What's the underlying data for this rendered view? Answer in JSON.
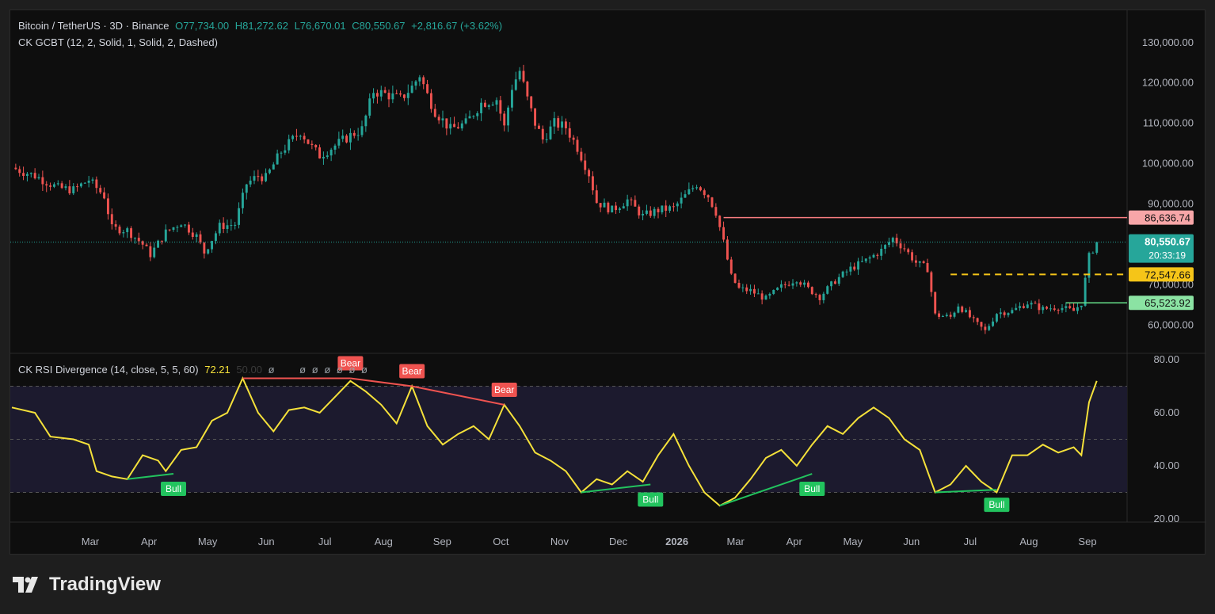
{
  "header": {
    "symbol": "Bitcoin / TetherUS · 3D · Binance",
    "open": "O77,734.00",
    "high": "H81,272.62",
    "low": "L76,670.01",
    "close": "C80,550.67",
    "change": "+2,816.67 (+3.62%)",
    "indicator1": "CK GCBT (12, 2, Solid, 1, Solid, 2, Dashed)"
  },
  "rsi_legend": {
    "title": "CK RSI Divergence (14, close, 5, 5, 60)",
    "value": "72.21",
    "secondary": "50.00",
    "empties": [
      "ø",
      "ø",
      "ø",
      "ø",
      "ø",
      "ø",
      "ø"
    ]
  },
  "colors": {
    "up": "#26a69a",
    "down": "#ef5350",
    "rsi": "#f5e13a",
    "bull": "#22c35e",
    "bear": "#ef5350",
    "resistance": "#f77c80",
    "mid": "#f5c518",
    "support": "#66e08a"
  },
  "price_labels": [
    {
      "value": "86,636.74",
      "price": 86636.74,
      "bg": "#f7a6a8",
      "fg": "#111"
    },
    {
      "value": "72,547.66",
      "price": 72547.66,
      "bg": "#f5c518",
      "fg": "#111"
    },
    {
      "value": "65,523.92",
      "price": 65523.92,
      "bg": "#8be3a3",
      "fg": "#111"
    }
  ],
  "current_price": {
    "value": "80,550.67",
    "countdown": "20:33:19",
    "price": 80550.67,
    "bg": "#26a69a"
  },
  "watermark": {
    "brand": "TradingView"
  },
  "chart_data": [
    {
      "type": "candlestick",
      "title": "Bitcoin / TetherUS · 3D · Binance",
      "y_ticks": [
        60000,
        70000,
        80000,
        90000,
        100000,
        110000,
        120000,
        130000
      ],
      "y_tick_labels": [
        "60,000.00",
        "70,000.00",
        "80,000.00",
        "90,000.00",
        "100,000.00",
        "110,000.00",
        "120,000.00",
        "130,000.00"
      ],
      "ylim": [
        53000,
        138000
      ],
      "x_labels": [
        "Mar",
        "Apr",
        "May",
        "Jun",
        "Jul",
        "Aug",
        "Sep",
        "Oct",
        "Nov",
        "Dec",
        "2026",
        "Mar",
        "Apr",
        "May",
        "Jun",
        "Jul",
        "Aug",
        "Sep"
      ],
      "bold_x_label": "2026",
      "close_path": [
        [
          0,
          99000
        ],
        [
          6,
          97000
        ],
        [
          12,
          94000
        ],
        [
          16,
          93500
        ],
        [
          20,
          96000
        ],
        [
          24,
          92000
        ],
        [
          26,
          84000
        ],
        [
          30,
          83500
        ],
        [
          34,
          80000
        ],
        [
          36,
          77500
        ],
        [
          40,
          83000
        ],
        [
          44,
          85500
        ],
        [
          48,
          82000
        ],
        [
          50,
          78000
        ],
        [
          54,
          84500
        ],
        [
          58,
          85000
        ],
        [
          61,
          95000
        ],
        [
          64,
          97000
        ],
        [
          66,
          96500
        ],
        [
          70,
          103000
        ],
        [
          72,
          105000
        ],
        [
          75,
          108000
        ],
        [
          78,
          104000
        ],
        [
          80,
          102000
        ],
        [
          84,
          104500
        ],
        [
          88,
          107000
        ],
        [
          91,
          108500
        ],
        [
          94,
          118000
        ],
        [
          98,
          117000
        ],
        [
          101,
          116000
        ],
        [
          104,
          119000
        ],
        [
          106,
          122000
        ],
        [
          108,
          117000
        ],
        [
          110,
          113000
        ],
        [
          114,
          108500
        ],
        [
          118,
          110000
        ],
        [
          122,
          115000
        ],
        [
          126,
          116000
        ],
        [
          128,
          109000
        ],
        [
          130,
          119000
        ],
        [
          132,
          123000
        ],
        [
          134,
          116000
        ],
        [
          136,
          110000
        ],
        [
          138,
          106000
        ],
        [
          141,
          110000
        ],
        [
          144,
          109000
        ],
        [
          147,
          104000
        ],
        [
          150,
          97500
        ],
        [
          152,
          90500
        ],
        [
          156,
          88500
        ],
        [
          160,
          91000
        ],
        [
          164,
          87000
        ],
        [
          168,
          88500
        ],
        [
          172,
          89000
        ],
        [
          175,
          92000
        ],
        [
          178,
          95000
        ],
        [
          181,
          92000
        ],
        [
          183,
          88000
        ],
        [
          185,
          80500
        ],
        [
          187,
          72000
        ],
        [
          189,
          69000
        ],
        [
          192,
          68500
        ],
        [
          196,
          66500
        ],
        [
          200,
          69500
        ],
        [
          204,
          71500
        ],
        [
          207,
          69000
        ],
        [
          210,
          67000
        ],
        [
          214,
          71000
        ],
        [
          218,
          74000
        ],
        [
          222,
          76000
        ],
        [
          226,
          78500
        ],
        [
          229,
          81500
        ],
        [
          232,
          79000
        ],
        [
          235,
          75500
        ],
        [
          238,
          74000
        ],
        [
          240,
          62500
        ],
        [
          244,
          62000
        ],
        [
          246,
          65000
        ],
        [
          250,
          61000
        ],
        [
          253,
          58500
        ],
        [
          256,
          63000
        ],
        [
          260,
          63500
        ],
        [
          264,
          65500
        ],
        [
          268,
          64000
        ],
        [
          272,
          64500
        ],
        [
          276,
          63500
        ],
        [
          278,
          65500
        ],
        [
          280,
          77000
        ],
        [
          282,
          80550
        ]
      ],
      "x_range": [
        0,
        287
      ],
      "horizontal_levels": [
        {
          "name": "resistance",
          "price": 86636.74,
          "from": 185,
          "style": "solid"
        },
        {
          "name": "mid",
          "price": 72547.66,
          "from": 244,
          "style": "dashed"
        },
        {
          "name": "support",
          "price": 65523.92,
          "from": 274,
          "style": "solid"
        }
      ]
    },
    {
      "type": "line",
      "title": "CK RSI Divergence (14, close, 5, 5, 60)",
      "y_ticks": [
        20,
        40,
        60,
        80
      ],
      "y_tick_labels": [
        "20.00",
        "40.00",
        "60.00",
        "80.00"
      ],
      "ylim": [
        20,
        80
      ],
      "band": [
        30,
        70
      ],
      "midline": 50,
      "rsi": [
        [
          0,
          62
        ],
        [
          6,
          60
        ],
        [
          10,
          51
        ],
        [
          16,
          50
        ],
        [
          20,
          48
        ],
        [
          22,
          38
        ],
        [
          26,
          36
        ],
        [
          30,
          35
        ],
        [
          34,
          44
        ],
        [
          38,
          42
        ],
        [
          40,
          38
        ],
        [
          44,
          46
        ],
        [
          48,
          47
        ],
        [
          52,
          57
        ],
        [
          56,
          60
        ],
        [
          60,
          73
        ],
        [
          64,
          60
        ],
        [
          68,
          53
        ],
        [
          72,
          61
        ],
        [
          76,
          62
        ],
        [
          80,
          60
        ],
        [
          84,
          66
        ],
        [
          88,
          72
        ],
        [
          92,
          68
        ],
        [
          96,
          63
        ],
        [
          100,
          56
        ],
        [
          104,
          70
        ],
        [
          108,
          55
        ],
        [
          112,
          48
        ],
        [
          116,
          52
        ],
        [
          120,
          55
        ],
        [
          124,
          50
        ],
        [
          128,
          63
        ],
        [
          132,
          55
        ],
        [
          136,
          45
        ],
        [
          140,
          42
        ],
        [
          144,
          38
        ],
        [
          148,
          30
        ],
        [
          152,
          35
        ],
        [
          156,
          33
        ],
        [
          160,
          38
        ],
        [
          164,
          34
        ],
        [
          168,
          44
        ],
        [
          172,
          52
        ],
        [
          176,
          40
        ],
        [
          180,
          30
        ],
        [
          184,
          25
        ],
        [
          188,
          28
        ],
        [
          192,
          35
        ],
        [
          196,
          43
        ],
        [
          200,
          46
        ],
        [
          204,
          40
        ],
        [
          208,
          48
        ],
        [
          212,
          55
        ],
        [
          216,
          52
        ],
        [
          220,
          58
        ],
        [
          224,
          62
        ],
        [
          228,
          58
        ],
        [
          232,
          50
        ],
        [
          236,
          46
        ],
        [
          240,
          30
        ],
        [
          244,
          33
        ],
        [
          248,
          40
        ],
        [
          252,
          34
        ],
        [
          256,
          30
        ],
        [
          260,
          44
        ],
        [
          264,
          44
        ],
        [
          268,
          48
        ],
        [
          272,
          45
        ],
        [
          276,
          47
        ],
        [
          278,
          44
        ],
        [
          280,
          64
        ],
        [
          282,
          72
        ]
      ],
      "divergences": [
        {
          "type": "Bull",
          "from": [
            30,
            35
          ],
          "to": [
            42,
            37
          ]
        },
        {
          "type": "Bear",
          "from": [
            60,
            73
          ],
          "to": [
            88,
            73
          ]
        },
        {
          "type": "Bear",
          "from": [
            88,
            73
          ],
          "to": [
            104,
            70
          ]
        },
        {
          "type": "Bear",
          "from": [
            104,
            70
          ],
          "to": [
            128,
            63
          ]
        },
        {
          "type": "Bull",
          "from": [
            148,
            30
          ],
          "to": [
            166,
            33
          ]
        },
        {
          "type": "Bull",
          "from": [
            184,
            25
          ],
          "to": [
            208,
            37
          ]
        },
        {
          "type": "Bull",
          "from": [
            240,
            30
          ],
          "to": [
            256,
            31
          ]
        }
      ],
      "labels": [
        {
          "text": "Bull",
          "at": [
            42,
            37
          ]
        },
        {
          "text": "Bear",
          "at": [
            88,
            73
          ]
        },
        {
          "text": "Bear",
          "at": [
            104,
            70
          ]
        },
        {
          "text": "Bear",
          "at": [
            128,
            63
          ]
        },
        {
          "text": "Bull",
          "at": [
            166,
            33
          ]
        },
        {
          "text": "Bull",
          "at": [
            208,
            37
          ]
        },
        {
          "text": "Bull",
          "at": [
            256,
            31
          ]
        }
      ]
    }
  ]
}
